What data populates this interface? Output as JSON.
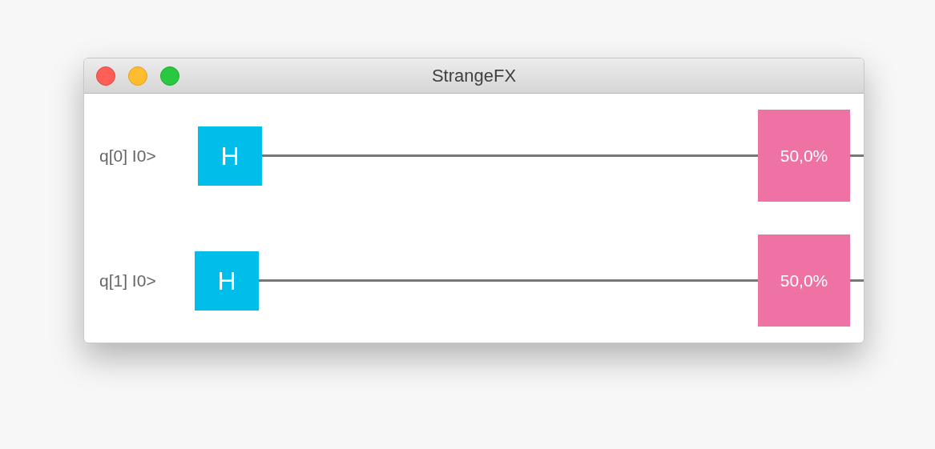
{
  "window": {
    "title": "StrangeFX"
  },
  "qubits": [
    {
      "label": "q[0] I0>",
      "gates": [
        {
          "kind": "hadamard",
          "text": "H"
        }
      ],
      "measurement": "50,0%"
    },
    {
      "label": "q[1] I0>",
      "gates": [
        {
          "kind": "hadamard",
          "text": "H"
        }
      ],
      "measurement": "50,0%"
    }
  ]
}
